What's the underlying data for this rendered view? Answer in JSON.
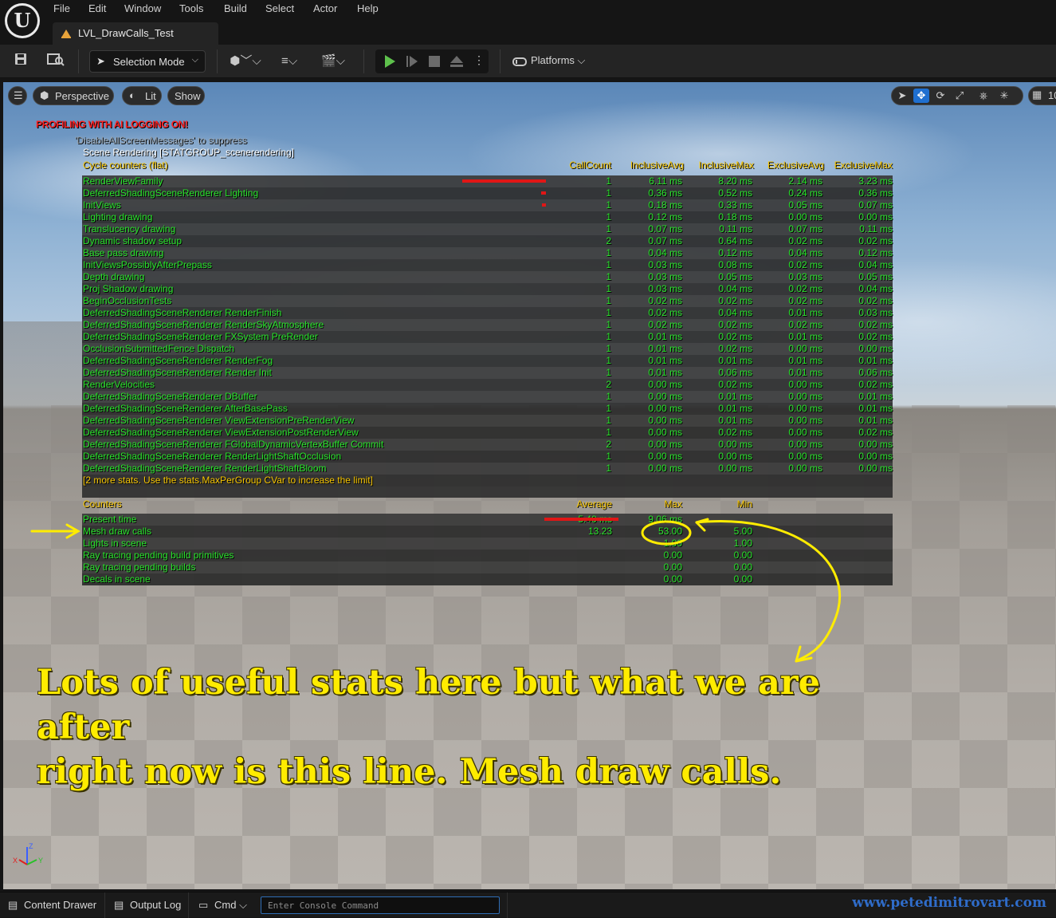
{
  "menu": {
    "items": [
      "File",
      "Edit",
      "Window",
      "Tools",
      "Build",
      "Select",
      "Actor",
      "Help"
    ],
    "level_tab": "LVL_DrawCalls_Test"
  },
  "toolbar": {
    "selection_mode": "Selection Mode",
    "platforms": "Platforms"
  },
  "viewport_bar": {
    "perspective": "Perspective",
    "lit": "Lit",
    "show": "Show",
    "grid_size": "10"
  },
  "messages": {
    "profiling": "PROFILING WITH AI LOGGING ON!",
    "disable": "'DisableAllScreenMessages' to suppress",
    "stat_group": "Scene Rendering [STATGROUP_scenerendering]"
  },
  "stats": {
    "headers": {
      "name": "Cycle counters (flat)",
      "count": "CallCount",
      "iavg": "InclusiveAvg",
      "imax": "InclusiveMax",
      "eavg": "ExclusiveAvg",
      "emax": "ExclusiveMax"
    },
    "rows": [
      {
        "name": "RenderViewFamily",
        "count": "1",
        "iavg": "6.11 ms",
        "imax": "8.20 ms",
        "eavg": "2.14 ms",
        "emax": "3.23 ms",
        "bar": 1.0
      },
      {
        "name": "DeferredShadingSceneRenderer Lighting",
        "count": "1",
        "iavg": "0.36 ms",
        "imax": "0.52 ms",
        "eavg": "0.24 ms",
        "emax": "0.36 ms",
        "bar": 0.06
      },
      {
        "name": "InitViews",
        "count": "1",
        "iavg": "0.18 ms",
        "imax": "0.33 ms",
        "eavg": "0.05 ms",
        "emax": "0.07 ms",
        "bar": 0.03
      },
      {
        "name": "Lighting drawing",
        "count": "1",
        "iavg": "0.12 ms",
        "imax": "0.18 ms",
        "eavg": "0.00 ms",
        "emax": "0.00 ms",
        "bar": 0
      },
      {
        "name": "Translucency drawing",
        "count": "1",
        "iavg": "0.07 ms",
        "imax": "0.11 ms",
        "eavg": "0.07 ms",
        "emax": "0.11 ms",
        "bar": 0
      },
      {
        "name": "Dynamic shadow setup",
        "count": "2",
        "iavg": "0.07 ms",
        "imax": "0.64 ms",
        "eavg": "0.02 ms",
        "emax": "0.02 ms",
        "bar": 0
      },
      {
        "name": "Base pass drawing",
        "count": "1",
        "iavg": "0.04 ms",
        "imax": "0.12 ms",
        "eavg": "0.04 ms",
        "emax": "0.12 ms",
        "bar": 0
      },
      {
        "name": "InitViewsPossiblyAfterPrepass",
        "count": "1",
        "iavg": "0.03 ms",
        "imax": "0.08 ms",
        "eavg": "0.02 ms",
        "emax": "0.04 ms",
        "bar": 0
      },
      {
        "name": "Depth drawing",
        "count": "1",
        "iavg": "0.03 ms",
        "imax": "0.05 ms",
        "eavg": "0.03 ms",
        "emax": "0.05 ms",
        "bar": 0
      },
      {
        "name": "Proj Shadow drawing",
        "count": "1",
        "iavg": "0.03 ms",
        "imax": "0.04 ms",
        "eavg": "0.02 ms",
        "emax": "0.04 ms",
        "bar": 0
      },
      {
        "name": "BeginOcclusionTests",
        "count": "1",
        "iavg": "0.02 ms",
        "imax": "0.02 ms",
        "eavg": "0.02 ms",
        "emax": "0.02 ms",
        "bar": 0
      },
      {
        "name": "DeferredShadingSceneRenderer RenderFinish",
        "count": "1",
        "iavg": "0.02 ms",
        "imax": "0.04 ms",
        "eavg": "0.01 ms",
        "emax": "0.03 ms",
        "bar": 0
      },
      {
        "name": "DeferredShadingSceneRenderer RenderSkyAtmosphere",
        "count": "1",
        "iavg": "0.02 ms",
        "imax": "0.02 ms",
        "eavg": "0.02 ms",
        "emax": "0.02 ms",
        "bar": 0
      },
      {
        "name": "DeferredShadingSceneRenderer FXSystem PreRender",
        "count": "1",
        "iavg": "0.01 ms",
        "imax": "0.02 ms",
        "eavg": "0.01 ms",
        "emax": "0.02 ms",
        "bar": 0
      },
      {
        "name": "OcclusionSubmittedFence Dispatch",
        "count": "1",
        "iavg": "0.01 ms",
        "imax": "0.02 ms",
        "eavg": "0.00 ms",
        "emax": "0.00 ms",
        "bar": 0
      },
      {
        "name": "DeferredShadingSceneRenderer RenderFog",
        "count": "1",
        "iavg": "0.01 ms",
        "imax": "0.01 ms",
        "eavg": "0.01 ms",
        "emax": "0.01 ms",
        "bar": 0
      },
      {
        "name": "DeferredShadingSceneRenderer Render Init",
        "count": "1",
        "iavg": "0.01 ms",
        "imax": "0.06 ms",
        "eavg": "0.01 ms",
        "emax": "0.06 ms",
        "bar": 0
      },
      {
        "name": "RenderVelocities",
        "count": "2",
        "iavg": "0.00 ms",
        "imax": "0.02 ms",
        "eavg": "0.00 ms",
        "emax": "0.02 ms",
        "bar": 0
      },
      {
        "name": "DeferredShadingSceneRenderer DBuffer",
        "count": "1",
        "iavg": "0.00 ms",
        "imax": "0.01 ms",
        "eavg": "0.00 ms",
        "emax": "0.01 ms",
        "bar": 0
      },
      {
        "name": "DeferredShadingSceneRenderer AfterBasePass",
        "count": "1",
        "iavg": "0.00 ms",
        "imax": "0.01 ms",
        "eavg": "0.00 ms",
        "emax": "0.01 ms",
        "bar": 0
      },
      {
        "name": "DeferredShadingSceneRenderer ViewExtensionPreRenderView",
        "count": "1",
        "iavg": "0.00 ms",
        "imax": "0.01 ms",
        "eavg": "0.00 ms",
        "emax": "0.01 ms",
        "bar": 0
      },
      {
        "name": "DeferredShadingSceneRenderer ViewExtensionPostRenderView",
        "count": "1",
        "iavg": "0.00 ms",
        "imax": "0.02 ms",
        "eavg": "0.00 ms",
        "emax": "0.02 ms",
        "bar": 0
      },
      {
        "name": "DeferredShadingSceneRenderer FGlobalDynamicVertexBuffer Commit",
        "count": "2",
        "iavg": "0.00 ms",
        "imax": "0.00 ms",
        "eavg": "0.00 ms",
        "emax": "0.00 ms",
        "bar": 0
      },
      {
        "name": "DeferredShadingSceneRenderer RenderLightShaftOcclusion",
        "count": "1",
        "iavg": "0.00 ms",
        "imax": "0.00 ms",
        "eavg": "0.00 ms",
        "emax": "0.00 ms",
        "bar": 0
      },
      {
        "name": "DeferredShadingSceneRenderer RenderLightShaftBloom",
        "count": "1",
        "iavg": "0.00 ms",
        "imax": "0.00 ms",
        "eavg": "0.00 ms",
        "emax": "0.00 ms",
        "bar": 0
      }
    ],
    "more_note": "[2 more stats. Use the stats.MaxPerGroup CVar to increase the limit]"
  },
  "counters": {
    "headers": {
      "name": "Counters",
      "avg": "Average",
      "max": "Max",
      "min": "Min"
    },
    "rows": [
      {
        "name": "Present time",
        "avg": "5.40 ms",
        "max": "9.06 ms",
        "min": "",
        "bar": 1.0
      },
      {
        "name": "Mesh draw calls",
        "avg": "13.23",
        "max": "53.00",
        "min": "5.00",
        "bar": 0
      },
      {
        "name": "Lights in scene",
        "avg": "",
        "max": "1.00",
        "min": "1.00",
        "bar": 0
      },
      {
        "name": "Ray tracing pending build primitives",
        "avg": "",
        "max": "0.00",
        "min": "0.00",
        "bar": 0
      },
      {
        "name": "Ray tracing pending builds",
        "avg": "",
        "max": "0.00",
        "min": "0.00",
        "bar": 0
      },
      {
        "name": "Decals in scene",
        "avg": "",
        "max": "0.00",
        "min": "0.00",
        "bar": 0
      }
    ]
  },
  "annotation": {
    "line1": "Lots of useful stats here but what we are after",
    "line2": "right now is this line. Mesh draw calls."
  },
  "axis": {
    "x": "X",
    "y": "Y",
    "z": "Z"
  },
  "bottombar": {
    "content_drawer": "Content Drawer",
    "output_log": "Output Log",
    "cmd": "Cmd",
    "console_placeholder": "Enter Console Command",
    "watermark": "www.petedimitrovart.com"
  },
  "colors": {
    "stat_text": "#28e22a",
    "header_text": "#f5c400",
    "bar": "#e01616",
    "annotation": "#ffec00"
  },
  "icons": [
    "unreal-logo-icon",
    "save-icon",
    "content-browser-icon",
    "add-actor-icon",
    "blueprint-icon",
    "cinematics-icon",
    "play-icon",
    "advance-frame-icon",
    "stop-icon",
    "eject-icon",
    "more-icon",
    "platforms-icon",
    "hamburger-icon",
    "perspective-cube-icon",
    "lit-icon",
    "select-icon",
    "translate-icon",
    "rotate-icon",
    "scale-icon",
    "grid-icon"
  ]
}
